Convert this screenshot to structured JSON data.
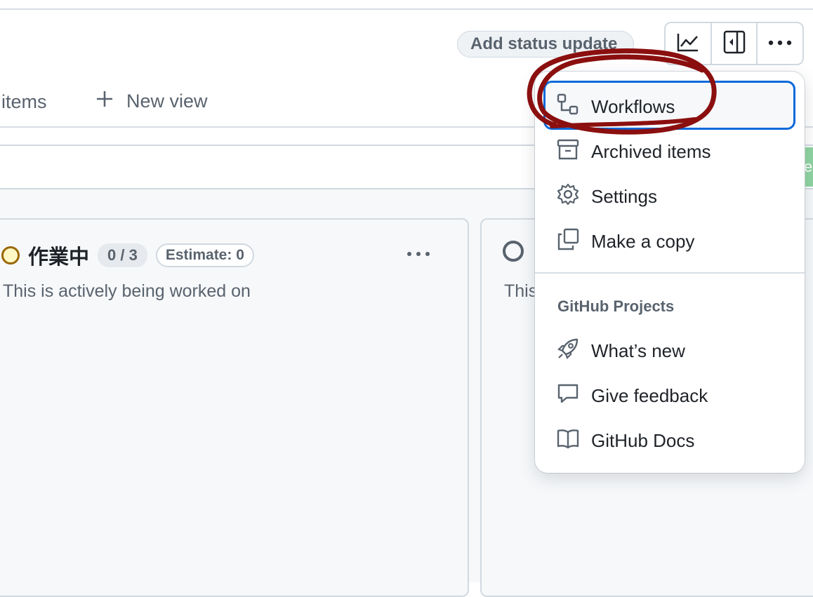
{
  "header": {
    "status_button": "Add status update",
    "icons": [
      "insights-icon",
      "sidebar-collapse-icon",
      "kebab-horizontal-icon"
    ]
  },
  "tabs": {
    "partial_tab": "items",
    "new_view": "New view",
    "new_view_icon": "plus-icon"
  },
  "filter_bar": {
    "partial_text": "e"
  },
  "columns": [
    {
      "status_color": "#9a6700",
      "title": "作業中",
      "count": "0 / 3",
      "estimate": "Estimate: 0",
      "more": "···",
      "description": "This is actively being worked on"
    },
    {
      "status_color": "#59636e",
      "description": "This"
    }
  ],
  "menu": {
    "items": [
      {
        "label": "Workflows",
        "icon": "workflow-icon",
        "focused": true
      },
      {
        "label": "Archived items",
        "icon": "archive-icon"
      },
      {
        "label": "Settings",
        "icon": "gear-icon"
      },
      {
        "label": "Make a copy",
        "icon": "copy-icon"
      }
    ],
    "group_label": "GitHub Projects",
    "group_items": [
      {
        "label": "What’s new",
        "icon": "rocket-icon"
      },
      {
        "label": "Give feedback",
        "icon": "comment-icon"
      },
      {
        "label": "GitHub Docs",
        "icon": "book-icon"
      }
    ]
  },
  "annotation_color": "#8b0f0f"
}
